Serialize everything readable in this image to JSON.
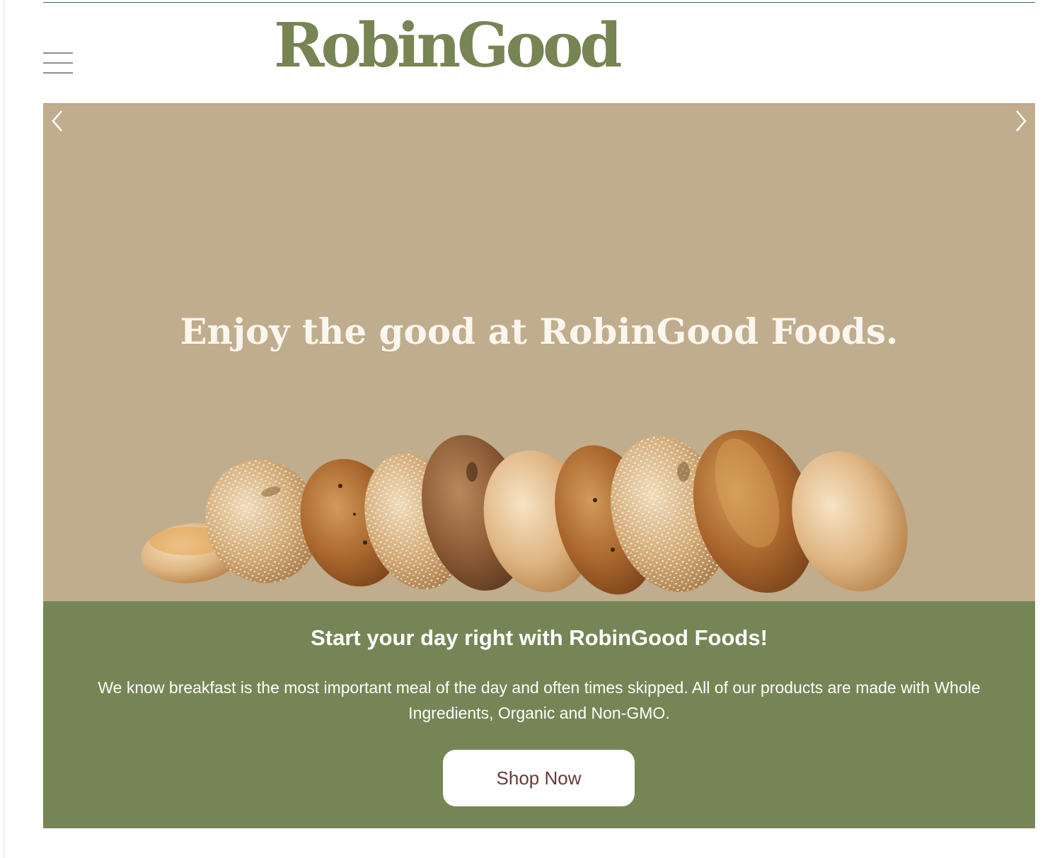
{
  "header": {
    "logo_text": "RobinGood",
    "menu_icon": "hamburger-menu-icon"
  },
  "hero": {
    "headline": "Enjoy the good at RobinGood Foods.",
    "prev_icon": "chevron-left-icon",
    "next_icon": "chevron-right-icon"
  },
  "intro": {
    "title": "Start your day right with RobinGood Foods!",
    "body": "We know breakfast is the most important meal of the day and often times skipped. All of our products are made with Whole Ingredients, Organic and Non-GMO.",
    "button_label": "Shop Now"
  },
  "colors": {
    "brand_green": "#778453",
    "band_green": "#768556",
    "hero_tan": "#bfad8d",
    "button_text": "#6a3a3a"
  }
}
